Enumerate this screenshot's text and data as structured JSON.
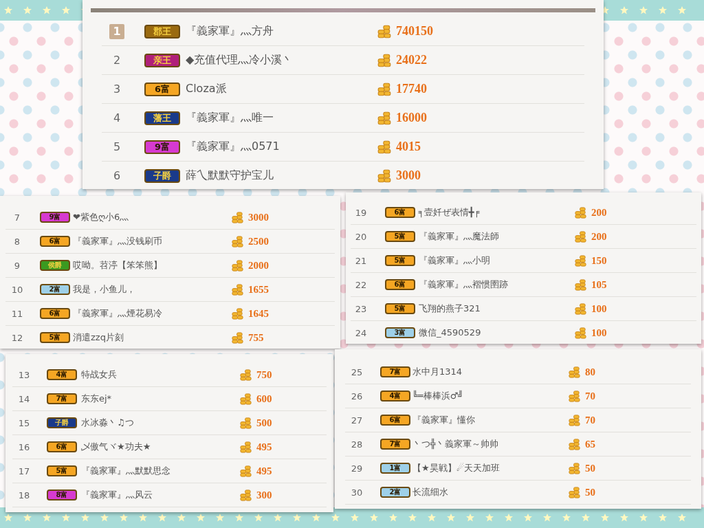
{
  "panels": [
    {
      "rows": [
        {
          "rank": "1",
          "highlighted": true,
          "badge": "郡王",
          "color": "#9a6a10",
          "name": "『義家軍』灬方舟",
          "amount": "740150"
        },
        {
          "rank": "2",
          "highlighted": false,
          "badge": "亲王",
          "color": "#b0207a",
          "name": "◆充值代理灬冷小溪丶",
          "amount": "24022"
        },
        {
          "rank": "3",
          "highlighted": false,
          "badge": "6富",
          "color": "#f5a623",
          "name": "Cloza派",
          "amount": "17740"
        },
        {
          "rank": "4",
          "highlighted": false,
          "badge": "藩王",
          "color": "#1a3a8a",
          "name": "『義家軍』灬唯一",
          "amount": "16000"
        },
        {
          "rank": "5",
          "highlighted": false,
          "badge": "9富",
          "color": "#d63ad0",
          "name": "『義家軍』灬0571",
          "amount": "4015"
        },
        {
          "rank": "6",
          "highlighted": false,
          "badge": "子爵",
          "color": "#1a3a8a",
          "name": "薛乀默默守护宝儿",
          "amount": "3000"
        }
      ]
    },
    {
      "rows": [
        {
          "rank": "7",
          "highlighted": false,
          "badge": "9富",
          "color": "#d63ad0",
          "name": "❤紫色ღ小6灬",
          "amount": "3000"
        },
        {
          "rank": "8",
          "highlighted": false,
          "badge": "6富",
          "color": "#f5a623",
          "name": "『義家軍』灬没钱刷币",
          "amount": "2500"
        },
        {
          "rank": "9",
          "highlighted": false,
          "badge": "侯爵",
          "color": "#3a9a20",
          "name": "哎呦。苕渟【笨笨熊】",
          "amount": "2000"
        },
        {
          "rank": "10",
          "highlighted": false,
          "badge": "2富",
          "color": "#9ed0e8",
          "name": "我是，小鱼儿，",
          "amount": "1655"
        },
        {
          "rank": "11",
          "highlighted": false,
          "badge": "6富",
          "color": "#f5a623",
          "name": "『義家軍』灬煙花易冷",
          "amount": "1645"
        },
        {
          "rank": "12",
          "highlighted": false,
          "badge": "5富",
          "color": "#f5a623",
          "name": "消遣zzq片刻",
          "amount": "755"
        }
      ]
    },
    {
      "rows": [
        {
          "rank": "19",
          "highlighted": false,
          "badge": "6富",
          "color": "#f5a623",
          "name": "╕壹奷ぜ表情╋╒",
          "amount": "200"
        },
        {
          "rank": "20",
          "highlighted": false,
          "badge": "5富",
          "color": "#f5a623",
          "name": "『義家軍』灬魔法師",
          "amount": "200"
        },
        {
          "rank": "21",
          "highlighted": false,
          "badge": "5富",
          "color": "#f5a623",
          "name": "『義家軍』灬小明",
          "amount": "150"
        },
        {
          "rank": "22",
          "highlighted": false,
          "badge": "6富",
          "color": "#f5a623",
          "name": "『義家軍』灬褶惯圉跡",
          "amount": "105"
        },
        {
          "rank": "23",
          "highlighted": false,
          "badge": "5富",
          "color": "#f5a623",
          "name": "飞翔的燕子321",
          "amount": "100"
        },
        {
          "rank": "24",
          "highlighted": false,
          "badge": "3富",
          "color": "#9ed0e8",
          "name": "微信_4590529",
          "amount": "100"
        }
      ]
    },
    {
      "rows": [
        {
          "rank": "13",
          "highlighted": false,
          "badge": "4富",
          "color": "#f5a623",
          "name": "特战女兵",
          "amount": "750"
        },
        {
          "rank": "14",
          "highlighted": false,
          "badge": "7富",
          "color": "#f5a623",
          "name": "东东ej*",
          "amount": "600"
        },
        {
          "rank": "15",
          "highlighted": false,
          "badge": "子爵",
          "color": "#1a3a8a",
          "name": "水冰淼丶♫つ",
          "amount": "500"
        },
        {
          "rank": "16",
          "highlighted": false,
          "badge": "6富",
          "color": "#f5a623",
          "name": "乄傲气ヾ★功夫★",
          "amount": "495"
        },
        {
          "rank": "17",
          "highlighted": false,
          "badge": "5富",
          "color": "#f5a623",
          "name": "『義家軍』灬默默思念",
          "amount": "495"
        },
        {
          "rank": "18",
          "highlighted": false,
          "badge": "8富",
          "color": "#d63ad0",
          "name": "『義家軍』灬风云",
          "amount": "300"
        }
      ]
    },
    {
      "rows": [
        {
          "rank": "25",
          "highlighted": false,
          "badge": "7富",
          "color": "#f5a623",
          "name": "水中月1314",
          "amount": "80"
        },
        {
          "rank": "26",
          "highlighted": false,
          "badge": "4富",
          "color": "#f5a623",
          "name": "╚═棒棒浜♂╝",
          "amount": "70"
        },
        {
          "rank": "27",
          "highlighted": false,
          "badge": "6富",
          "color": "#f5a623",
          "name": "『義家軍』懂你",
          "amount": "70"
        },
        {
          "rank": "28",
          "highlighted": false,
          "badge": "7富",
          "color": "#f5a623",
          "name": "丶つ╬丶義家軍～帅帅",
          "amount": "65"
        },
        {
          "rank": "29",
          "highlighted": false,
          "badge": "1富",
          "color": "#9ed0e8",
          "name": "【★昊戦】☄天天加班",
          "amount": "50"
        },
        {
          "rank": "30",
          "highlighted": false,
          "badge": "2富",
          "color": "#9ed0e8",
          "name": "长流细水",
          "amount": "50"
        }
      ]
    }
  ]
}
